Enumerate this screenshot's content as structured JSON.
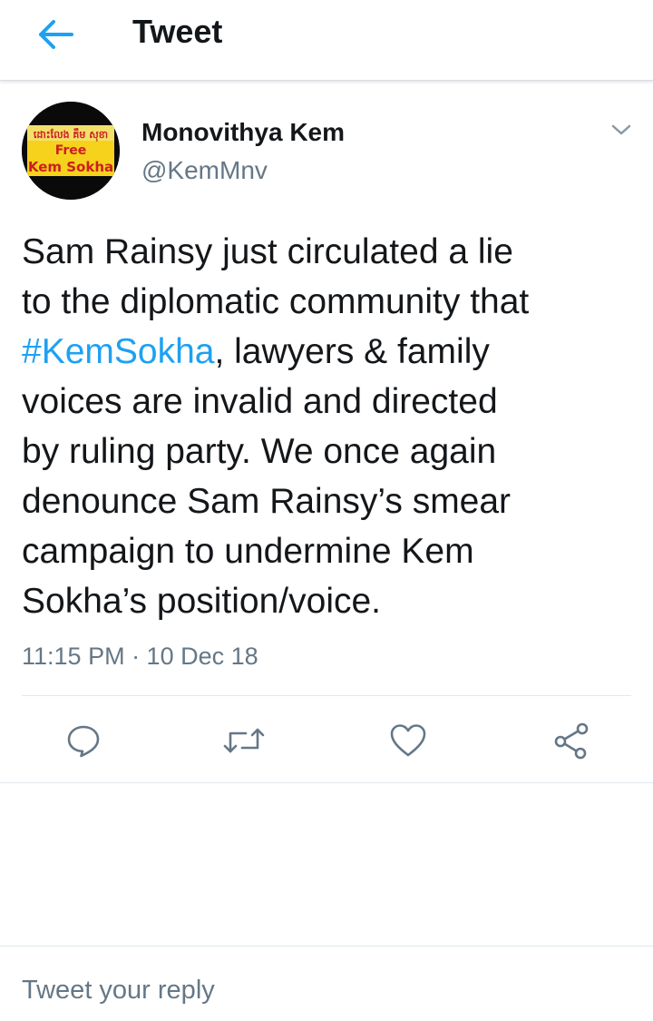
{
  "header": {
    "title": "Tweet",
    "back_icon": "arrow-left-icon",
    "accent_color": "#1da1f2"
  },
  "tweet": {
    "author": {
      "display_name": "Monovithya Kem",
      "handle": "@KemMnv",
      "avatar": {
        "line1": "ដោះលែង គឹម សុខា",
        "line2": "Free",
        "line3": "Kem Sokha"
      }
    },
    "more_icon": "chevron-down-icon",
    "text_lines": {
      "l1": "Sam Rainsy just circulated a lie",
      "l2": "to the diplomatic community that",
      "l3_hashtag": "#KemSokha",
      "l3_rest": ", lawyers & family",
      "l4": "voices are invalid and directed",
      "l5": "by ruling party. We once again",
      "l6": "denounce Sam Rainsy’s smear",
      "l7": "campaign to undermine Kem",
      "l8": "Sokha’s position/voice."
    },
    "timestamp": "11:15 PM · 10 Dec 18",
    "actions": [
      "reply-icon",
      "retweet-icon",
      "like-icon",
      "share-icon"
    ]
  },
  "reply": {
    "placeholder": "Tweet your reply"
  }
}
